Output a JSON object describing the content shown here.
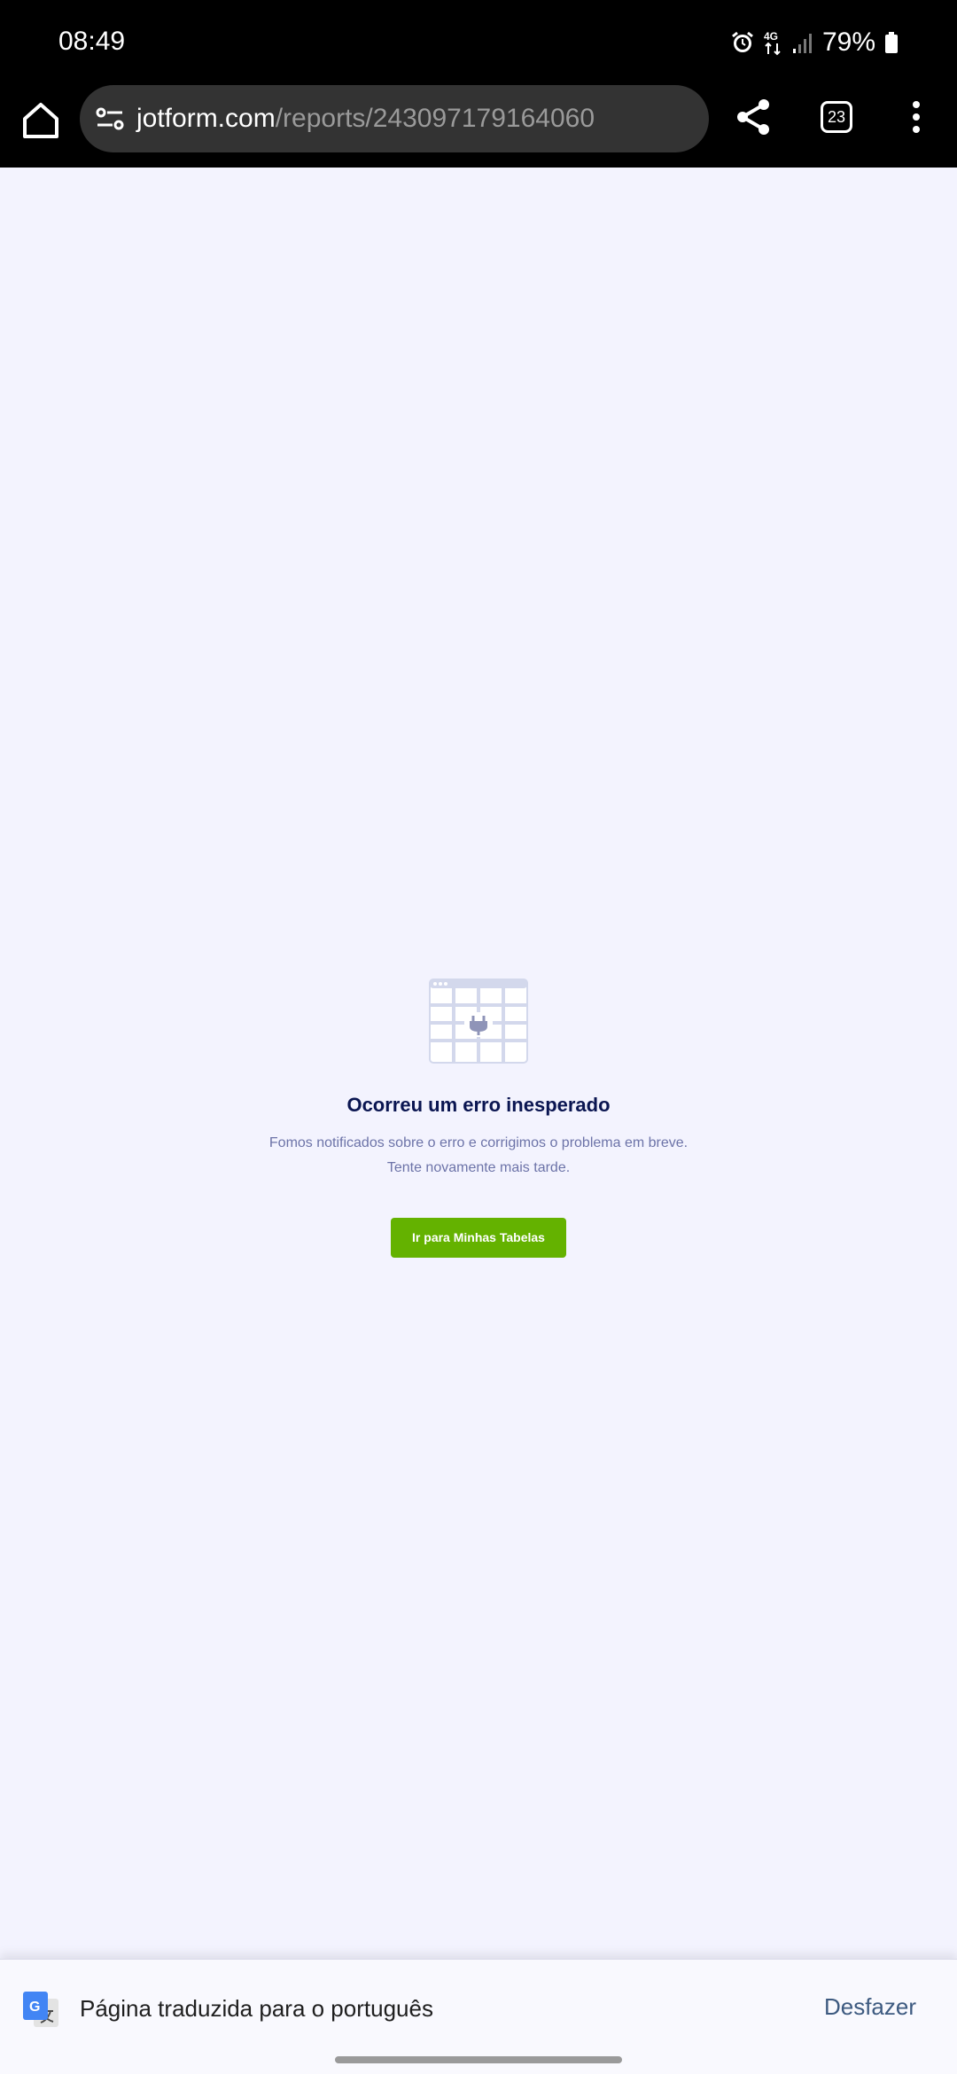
{
  "status_bar": {
    "time": "08:49",
    "network": "4G",
    "battery": "79%"
  },
  "browser": {
    "url_domain": "jotform.com",
    "url_path": "/reports/243097179164060",
    "tab_count": "23"
  },
  "error": {
    "title": "Ocorreu um erro inesperado",
    "line1": "Fomos notificados sobre o erro e corrigimos o problema em breve.",
    "line2": "Tente novamente mais tarde.",
    "button_label": "Ir para Minhas Tabelas",
    "button_color": "#64b200"
  },
  "translate_bar": {
    "message": "Página traduzida para o português",
    "undo_label": "Desfazer"
  }
}
